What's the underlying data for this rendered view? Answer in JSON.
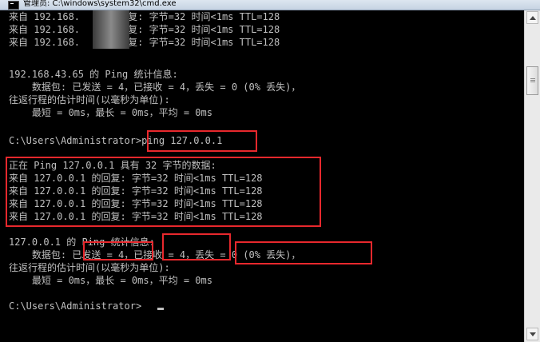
{
  "window": {
    "title": "管理员: C:\\windows\\system32\\cmd.exe"
  },
  "console": {
    "lines": [
      "来自 192.168.     的回复: 字节=32 时间<1ms TTL=128",
      "来自 192.168.     的回复: 字节=32 时间<1ms TTL=128",
      "来自 192.168.     的回复: 字节=32 时间<1ms TTL=128",
      "",
      "192.168.43.65 的 Ping 统计信息:",
      "    数据包: 已发送 = 4，已接收 = 4，丢失 = 0 (0% 丢失)，",
      "往返行程的估计时间(以毫秒为单位):",
      "    最短 = 0ms，最长 = 0ms，平均 = 0ms",
      "",
      "C:\\Users\\Administrator>ping 127.0.0.1",
      "",
      "正在 Ping 127.0.0.1 具有 32 字节的数据:",
      "来自 127.0.0.1 的回复: 字节=32 时间<1ms TTL=128",
      "来自 127.0.0.1 的回复: 字节=32 时间<1ms TTL=128",
      "来自 127.0.0.1 的回复: 字节=32 时间<1ms TTL=128",
      "来自 127.0.0.1 的回复: 字节=32 时间<1ms TTL=128",
      "",
      "127.0.0.1 的 Ping 统计信息:",
      "    数据包: 已发送 = 4，已接收 = 4，丢失 = 0 (0% 丢失)，",
      "往返行程的估计时间(以毫秒为单位):",
      "    最短 = 0ms，最长 = 0ms，平均 = 0ms",
      "",
      "C:\\Users\\Administrator>"
    ]
  },
  "colors": {
    "console_bg": "#000000",
    "console_text": "#c0c0c0",
    "highlight": "#e8282d"
  },
  "icons": {
    "app": "cmd-icon",
    "scroll_up": "arrow-up-icon",
    "scroll_down": "arrow-down-icon"
  }
}
